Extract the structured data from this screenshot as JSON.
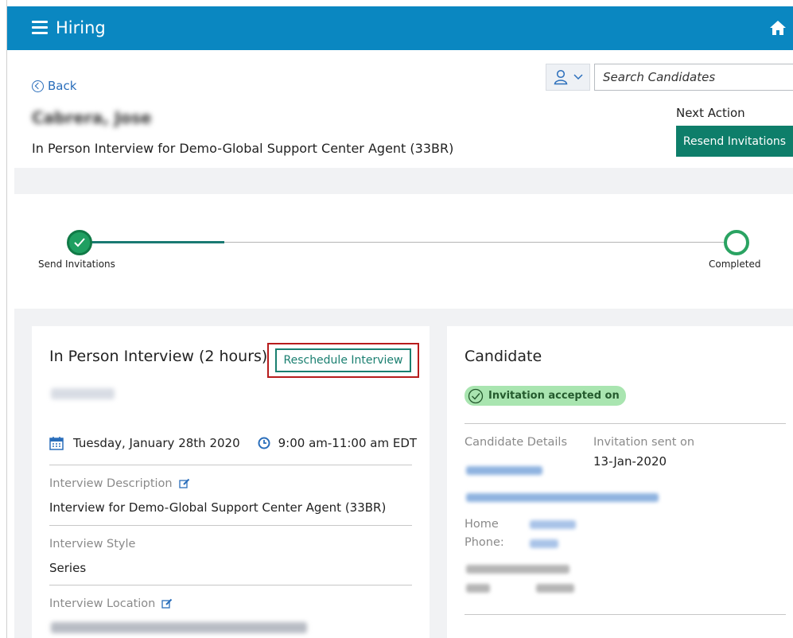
{
  "app": {
    "title": "Hiring"
  },
  "header": {
    "back_label": "Back",
    "candidate_name": "Cabrera, Jose",
    "subtitle": "In Person Interview for Demo-Global Support Center Agent (33BR)",
    "search_placeholder": "Search Candidates",
    "next_action_label": "Next Action",
    "resend_label": "Resend Invitations"
  },
  "progress": {
    "steps": [
      {
        "label": "Send Invitations",
        "status": "done"
      },
      {
        "label": "Completed",
        "status": "pending"
      }
    ]
  },
  "interview": {
    "title": "In Person Interview (2 hours)",
    "reschedule_label": "Reschedule Interview",
    "date": "Tuesday, January 28th 2020",
    "time": "9:00 am-11:00 am EDT",
    "description_label": "Interview Description",
    "description_value": "Interview for Demo-Global Support Center Agent (33BR)",
    "style_label": "Interview Style",
    "style_value": "Series",
    "location_label": "Interview Location"
  },
  "candidate": {
    "title": "Candidate",
    "badge": "Invitation accepted on",
    "details_label": "Candidate Details",
    "invite_sent_label": "Invitation sent on",
    "invite_sent_value": "13-Jan-2020",
    "home_label": "Home",
    "phone_label": "Phone:"
  },
  "colors": {
    "topbar": "#0a87c1",
    "primary_button": "#0e7e6a",
    "link": "#2a6ebb",
    "success": "#1f9f61",
    "highlight_box": "#b71c1c"
  }
}
